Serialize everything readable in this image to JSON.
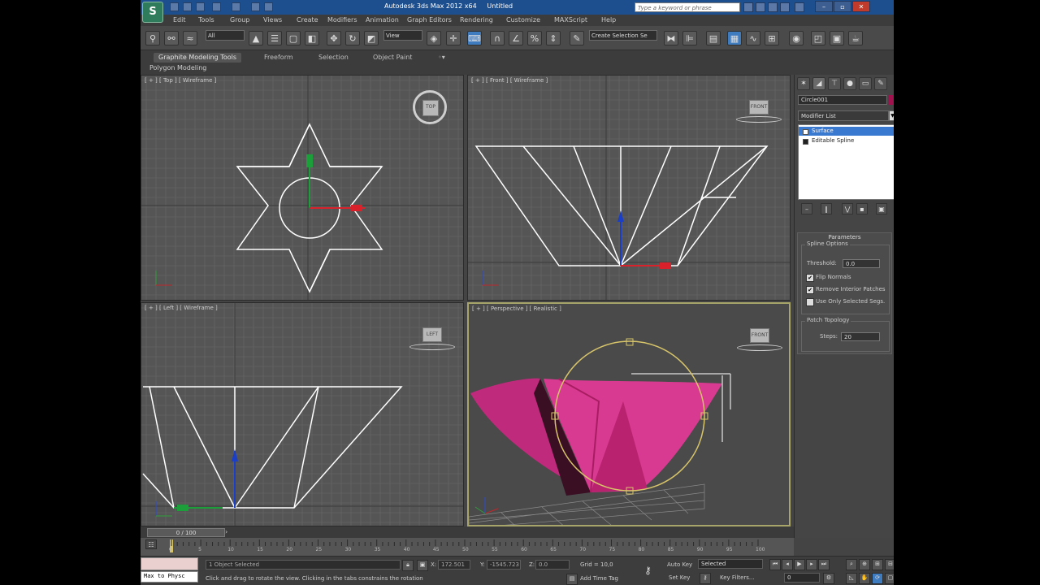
{
  "app": {
    "title": "Autodesk 3ds Max 2012 x64",
    "document": "Untitled",
    "icon_label": "S",
    "search_placeholder": "Type a keyword or phrase"
  },
  "menu": [
    "Edit",
    "Tools",
    "Group",
    "Views",
    "Create",
    "Modifiers",
    "Animation",
    "Graph Editors",
    "Rendering",
    "Customize",
    "MAXScript",
    "Help"
  ],
  "toolbar": {
    "selection_filter": "All",
    "ref_coord": "View",
    "named_selection": "Create Selection Se"
  },
  "ribbon": {
    "tabs": [
      "Graphite Modeling Tools",
      "Freeform",
      "Selection",
      "Object Paint"
    ],
    "panel": "Polygon Modeling"
  },
  "viewports": {
    "top": {
      "label": "[ + ] [ Top ] [ Wireframe ]",
      "cube": "TOP"
    },
    "front": {
      "label": "[ + ] [ Front ] [ Wireframe ]",
      "cube": "FRONT"
    },
    "left": {
      "label": "[ + ] [ Left ] [ Wireframe ]",
      "cube": "LEFT"
    },
    "perspective": {
      "label": "[ + ] [ Perspective ] [ Realistic ]",
      "cube": "FRONT"
    }
  },
  "command_panel": {
    "object_name": "Circle001",
    "object_color": "#a0124e",
    "modifier_list": "Modifier List",
    "stack": [
      "Surface",
      "Editable Spline"
    ],
    "rollout_title": "Parameters",
    "spline_options": {
      "title": "Spline Options",
      "threshold_label": "Threshold:",
      "threshold_value": "0.0",
      "flip_normals": "Flip Normals",
      "remove_interior": "Remove Interior Patches",
      "use_only_selected": "Use Only Selected Segs."
    },
    "patch_topology": {
      "title": "Patch Topology",
      "steps_label": "Steps:",
      "steps_value": "20"
    }
  },
  "timeline": {
    "position": "0 / 100",
    "ticks": [
      "0",
      "5",
      "10",
      "15",
      "20",
      "25",
      "30",
      "35",
      "40",
      "45",
      "50",
      "55",
      "60",
      "65",
      "70",
      "75",
      "80",
      "85",
      "90",
      "95",
      "100"
    ]
  },
  "status": {
    "maxscript": "Max to Physc",
    "selected": "1 Object Selected",
    "prompt": "Click and drag to rotate the view.  Clicking in the tabs constrains the rotation",
    "x_label": "X:",
    "x_value": "172.501",
    "y_label": "Y:",
    "y_value": "-1545.723",
    "z_label": "Z:",
    "z_value": "0.0",
    "grid": "Grid = 10,0",
    "add_time_tag": "Add Time Tag",
    "auto_key": "Auto Key",
    "set_key": "Set Key",
    "key_mode": "Selected",
    "key_filters": "Key Filters...",
    "frame": "0"
  },
  "colors": {
    "accent": "#3f7bbf",
    "object": "#c02a7c",
    "gizmo": "#d8c56a",
    "wire": "#ffffff",
    "titlebar": "#1d4f8f"
  }
}
